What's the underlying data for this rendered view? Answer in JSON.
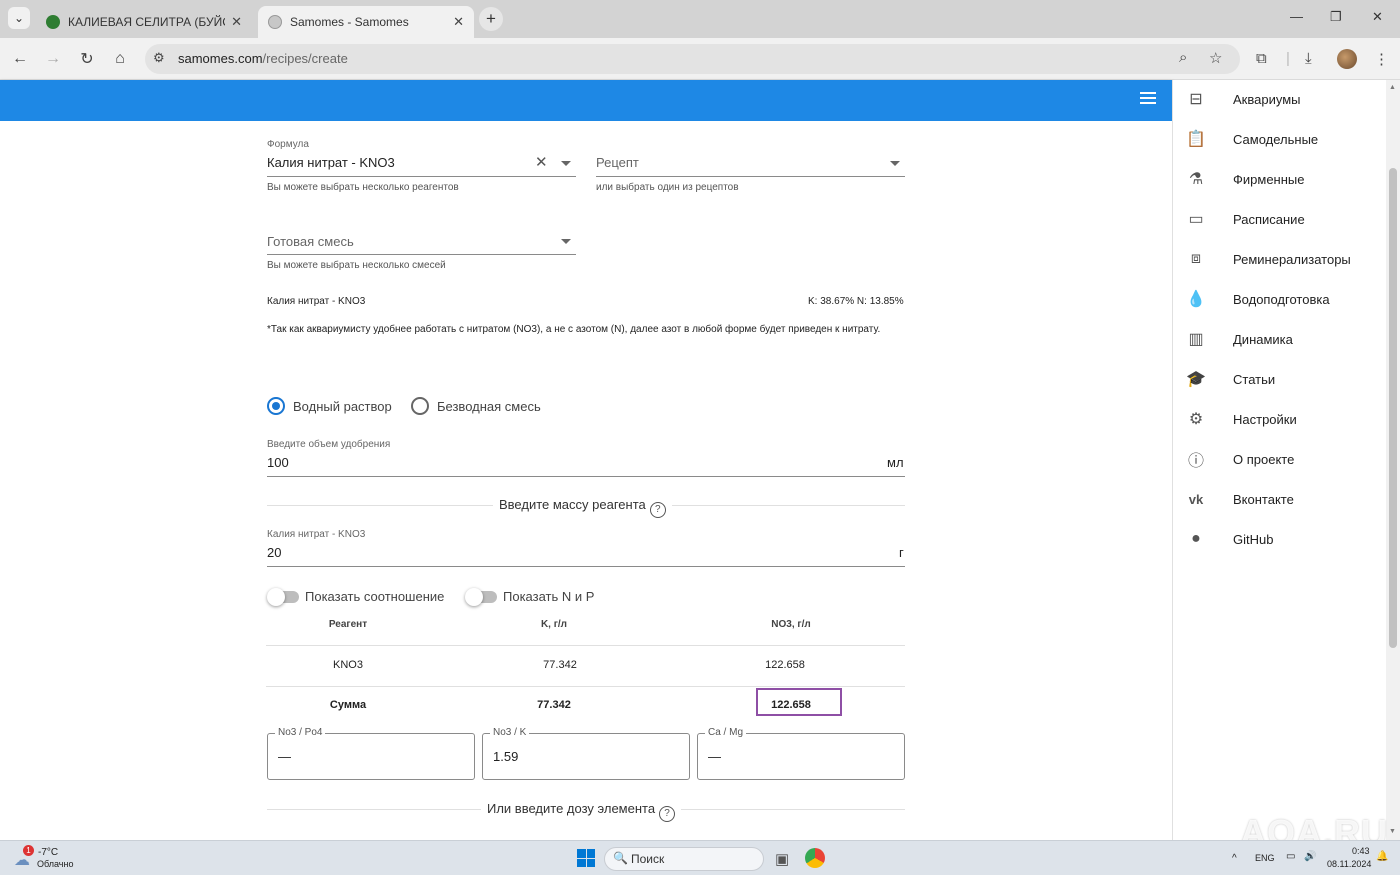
{
  "browser": {
    "tabs": [
      {
        "title": "КАЛИЕВАЯ СЕЛИТРА (БУЙСКИ",
        "active": false
      },
      {
        "title": "Samomes - Samomes",
        "active": true
      }
    ],
    "url_host": "samomes.com",
    "url_path": "/recipes/create"
  },
  "form": {
    "formula": {
      "label": "Формула",
      "value": "Калия нитрат - KNO3",
      "hint": "Вы можете выбрать несколько реагентов"
    },
    "recipe": {
      "placeholder": "Рецепт",
      "hint": "или выбрать один из рецептов"
    },
    "mix": {
      "placeholder": "Готовая смесь",
      "hint": "Вы можете выбрать несколько смесей"
    },
    "reagent_name": "Калия нитрат - KNO3",
    "reagent_composition": "K: 38.67% N: 13.85%",
    "note": "*Так как аквариумисту удобнее работать с нитратом (NO3), а не с азотом (N), далее азот в любой форме будет приведен к нитрату.",
    "radio_aqueous": "Водный раствор",
    "radio_dry": "Безводная смесь",
    "volume": {
      "label": "Введите объем удобрения",
      "value": "100",
      "unit": "мл"
    },
    "mass_section_title": "Введите массу реагента",
    "mass": {
      "label": "Калия нитрат - KNO3",
      "value": "20",
      "unit": "г"
    },
    "toggle_ratio": "Показать соотношение",
    "toggle_np": "Показать N и P",
    "table": {
      "headers": [
        "Реагент",
        "K, г/л",
        "NO3, г/л"
      ],
      "rows": [
        [
          "KNO3",
          "77.342",
          "122.658"
        ]
      ],
      "total": [
        "Сумма",
        "77.342",
        "122.658"
      ]
    },
    "ratios": [
      {
        "label": "No3 / Po4",
        "value": "—"
      },
      {
        "label": "No3 / K",
        "value": "1.59"
      },
      {
        "label": "Ca / Mg",
        "value": "—"
      }
    ],
    "dose_section_title": "Или введите дозу элемента"
  },
  "sidebar": {
    "items": [
      {
        "label": "Аквариумы",
        "icon": "aquarium-icon"
      },
      {
        "label": "Самодельные",
        "icon": "clipboard-icon"
      },
      {
        "label": "Фирменные",
        "icon": "flask-icon"
      },
      {
        "label": "Расписание",
        "icon": "calendar-icon"
      },
      {
        "label": "Реминерализаторы",
        "icon": "boxes-icon"
      },
      {
        "label": "Водоподготовка",
        "icon": "drop-icon"
      },
      {
        "label": "Динамика",
        "icon": "chart-icon"
      },
      {
        "label": "Статьи",
        "icon": "school-icon"
      },
      {
        "label": "Настройки",
        "icon": "gear-icon"
      },
      {
        "label": "О проекте",
        "icon": "info-icon"
      },
      {
        "label": "Вконтакте",
        "icon": "vk-icon"
      },
      {
        "label": "GitHub",
        "icon": "github-icon"
      }
    ]
  },
  "taskbar": {
    "weather_temp": "-7°C",
    "weather_text": "Облачно",
    "weather_badge": "1",
    "search_label": "Поиск",
    "lang": "ENG",
    "time": "0:43",
    "date": "08.11.2024"
  },
  "watermark": "AQA.RU",
  "colors": {
    "appbar": "#1e88e5",
    "radio_on": "#1976d2",
    "highlight": "#8e4fa5"
  }
}
